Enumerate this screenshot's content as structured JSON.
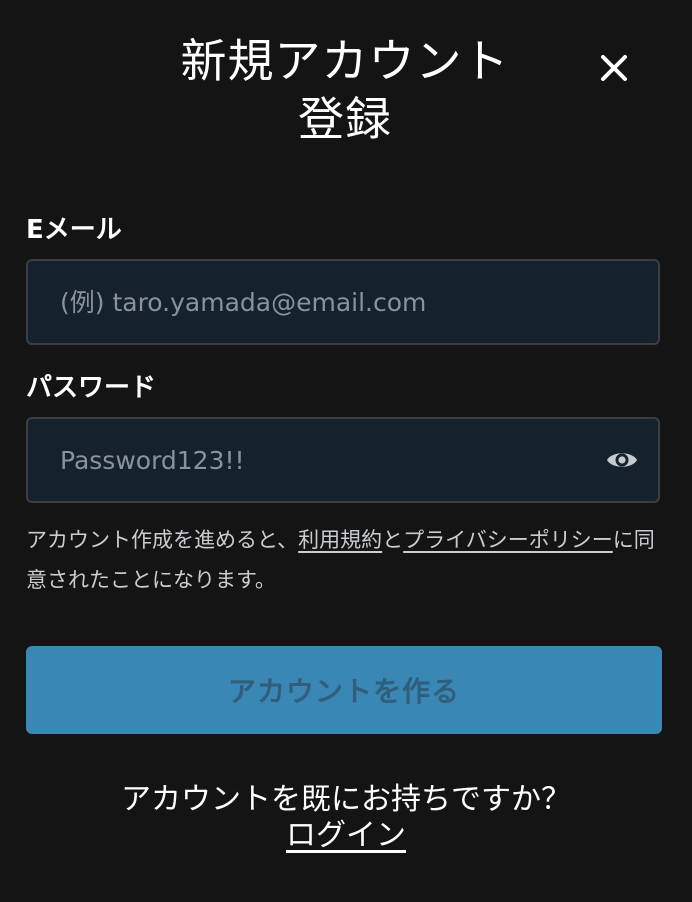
{
  "dialog": {
    "title_line1": "新規アカウント",
    "title_line2": "登録",
    "close_icon": "close-icon"
  },
  "form": {
    "email": {
      "label": "Eメール",
      "placeholder": "(例) taro.yamada@email.com",
      "value": ""
    },
    "password": {
      "label": "パスワード",
      "value": "Password123!!",
      "toggle_icon": "eye-icon"
    },
    "terms": {
      "prefix": "アカウント作成を進めると、",
      "terms_link": "利用規約",
      "connector": "と",
      "privacy_link": "プライバシーポリシー",
      "suffix": "に同意されたことになります。"
    },
    "submit_label": "アカウントを作る"
  },
  "footer": {
    "question": "アカウントを既にお持ちですか？",
    "login_link": "ログイン"
  },
  "colors": {
    "background": "#141414",
    "input_background": "#15212d",
    "button_background": "#3a86b4",
    "button_text": "#2f5f7c"
  }
}
